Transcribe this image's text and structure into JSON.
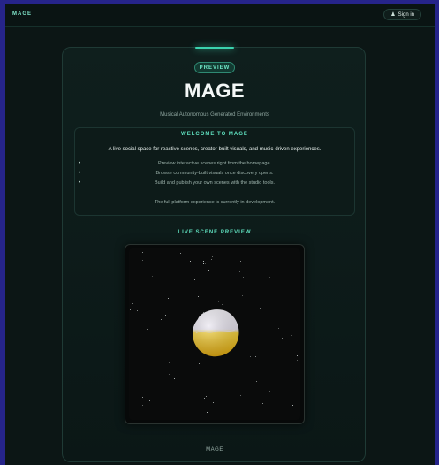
{
  "topbar": {
    "brand": "MAGE",
    "signin_label": "Sign in",
    "signin_icon": "person-icon"
  },
  "hero": {
    "badge": "PREVIEW",
    "title": "MAGE",
    "subtitle": "Musical Autonomous Generated Environments"
  },
  "welcome": {
    "heading": "WELCOME TO MAGE",
    "intro": "A live social space for reactive scenes, creator-built visuals, and music-driven experiences.",
    "features": [
      "Preview interactive scenes right from the homepage.",
      "Browse community-built visuals once discovery opens.",
      "Build and publish your own scenes with the studio tools."
    ],
    "note": "The full platform experience is currently in development."
  },
  "preview": {
    "heading": "LIVE SCENE PREVIEW",
    "scene_object": "blob-object",
    "caption": "MAGE"
  },
  "colors": {
    "accent": "#5fe0bf",
    "background": "#0c1615",
    "blob_top": "#f0eef5",
    "blob_bottom": "#f2c21a"
  }
}
